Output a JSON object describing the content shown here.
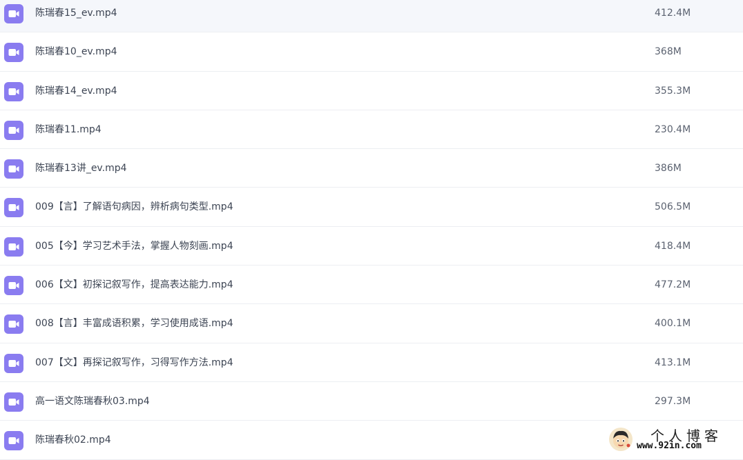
{
  "files": [
    {
      "name": "陈瑞春15_ev.mp4",
      "size": "412.4M",
      "icon": "video-file-icon"
    },
    {
      "name": "陈瑞春10_ev.mp4",
      "size": "368M",
      "icon": "video-file-icon"
    },
    {
      "name": "陈瑞春14_ev.mp4",
      "size": "355.3M",
      "icon": "video-file-icon"
    },
    {
      "name": "陈瑞春11.mp4",
      "size": "230.4M",
      "icon": "video-file-icon"
    },
    {
      "name": "陈瑞春13讲_ev.mp4",
      "size": "386M",
      "icon": "video-file-icon"
    },
    {
      "name": "009【言】了解语句病因，辨析病句类型.mp4",
      "size": "506.5M",
      "icon": "video-file-icon"
    },
    {
      "name": "005【今】学习艺术手法，掌握人物刻画.mp4",
      "size": "418.4M",
      "icon": "video-file-icon"
    },
    {
      "name": "006【文】初探记叙写作，提高表达能力.mp4",
      "size": "477.2M",
      "icon": "video-file-icon"
    },
    {
      "name": "008【言】丰富成语积累，学习使用成语.mp4",
      "size": "400.1M",
      "icon": "video-file-icon"
    },
    {
      "name": "007【文】再探记叙写作，习得写作方法.mp4",
      "size": "413.1M",
      "icon": "video-file-icon"
    },
    {
      "name": "高一语文陈瑞春秋03.mp4",
      "size": "297.3M",
      "icon": "video-file-icon"
    },
    {
      "name": "陈瑞春秋02.mp4",
      "size": "",
      "icon": "video-file-icon"
    }
  ],
  "watermark": {
    "title": "个人博客",
    "url": "www.92in.com"
  },
  "colors": {
    "icon_bg": "#8a7cf0",
    "row_divider": "#eceef2",
    "text": "#3c4453"
  }
}
